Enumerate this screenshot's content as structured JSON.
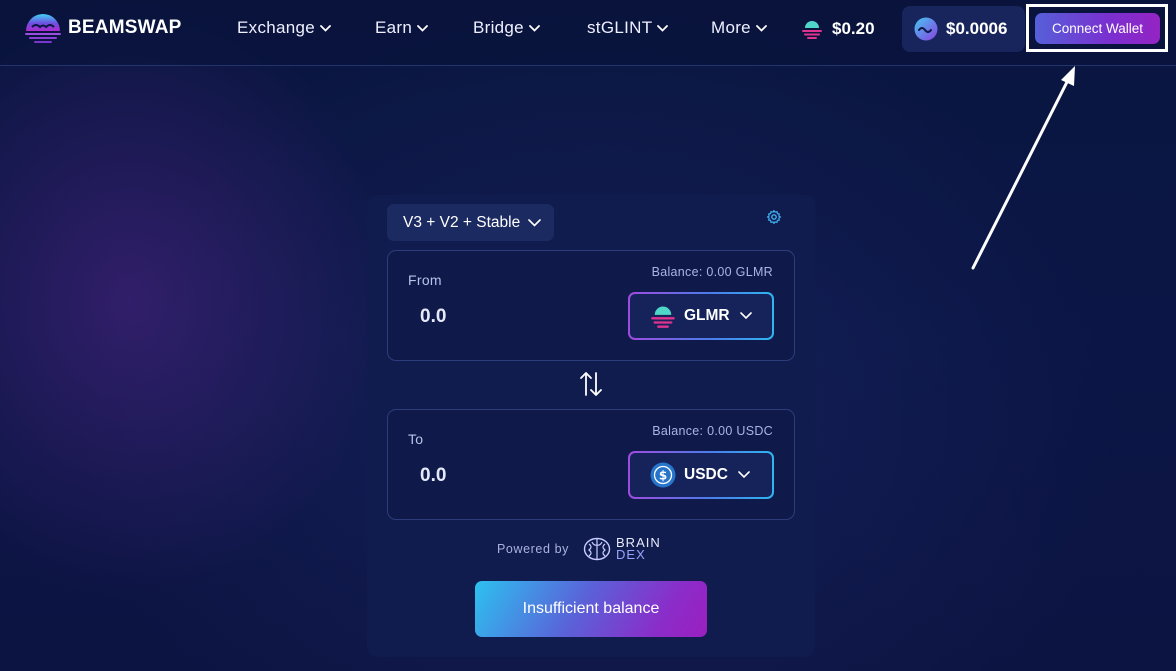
{
  "header": {
    "logo_text": "BEAMSWAP",
    "nav": [
      {
        "label": "Exchange"
      },
      {
        "label": "Earn"
      },
      {
        "label": "Bridge"
      },
      {
        "label": "stGLINT"
      },
      {
        "label": "More"
      }
    ],
    "glmr_price": "$0.20",
    "glint_price": "$0.0006",
    "connect_wallet": "Connect Wallet"
  },
  "swap": {
    "route_label": "V3 + V2 + Stable",
    "from": {
      "label": "From",
      "balance": "Balance: 0.00 GLMR",
      "amount": "0.0",
      "token": "GLMR"
    },
    "to": {
      "label": "To",
      "balance": "Balance: 0.00 USDC",
      "amount": "0.0",
      "token": "USDC"
    },
    "powered_by": "Powered by",
    "provider": {
      "line1": "BRAIN",
      "line2": "DEX"
    },
    "submit_label": "Insufficient balance"
  },
  "colors": {
    "background": "#0b1646",
    "card": "#111c4e",
    "accent_purple": "#8b2cc9",
    "accent_cyan": "#2dc1f0"
  },
  "icons": {
    "logo": "beamswap-logo-icon",
    "nav_dropdown": "chevron-down-icon",
    "glmr": "glmr-token-icon",
    "glint": "glint-token-icon",
    "settings": "gear-icon",
    "switch": "swap-arrows-icon",
    "usdc": "usdc-token-icon",
    "braindex": "brain-icon"
  }
}
